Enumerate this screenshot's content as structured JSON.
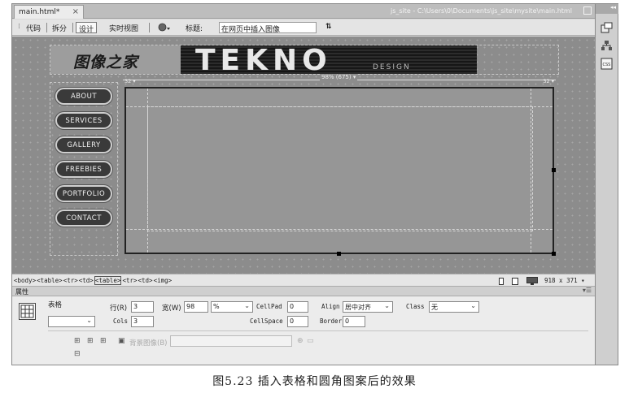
{
  "tab": {
    "label": "main.html*",
    "close": "×"
  },
  "window_path": "js_site - C:\\Users\\0\\Documents\\js_site\\mysite\\main.html",
  "toolbar": {
    "code": "代码",
    "split": "拆分",
    "design": "设计",
    "live_view": "实时视图",
    "title_label": "标题:",
    "title_value": "在网页中插入图像",
    "sort_icon": "⇅"
  },
  "page": {
    "logo_text": "图像之家",
    "banner_text": "TEKNO",
    "banner_sub": "DESIGN",
    "nav_buttons": [
      "ABOUT",
      "SERVICES",
      "GALLERY",
      "FREEBIES",
      "PORTFOLIO",
      "CONTACT"
    ],
    "ruler_label": "98% (675) ▾",
    "ruler_left": "32 ▾",
    "ruler_right": "32 ▾"
  },
  "status": {
    "tags": [
      "<body>",
      "<table>",
      "<tr>",
      "<td>",
      "<table>",
      "<tr>",
      "<td>",
      "<img>"
    ],
    "selected_tag_index": 4,
    "size": "918 x 371 ▾"
  },
  "properties": {
    "panel_title": "属性",
    "object_label": "表格",
    "rows_label": "行(R)",
    "rows_value": "3",
    "width_label": "宽(W)",
    "width_value": "98",
    "width_unit": "%",
    "cols_label": "Cols",
    "cols_value": "3",
    "cellpad_label": "CellPad",
    "cellpad_value": "0",
    "cellspace_label": "CellSpace",
    "cellspace_value": "0",
    "align_label": "Align",
    "align_value": "居中对齐",
    "border_label": "Border",
    "border_value": "0",
    "class_label": "Class",
    "class_value": "无",
    "bg_label": "背景图像(B)"
  },
  "caption": "图5.23    插入表格和圆角图案后的效果",
  "icons": {
    "right_strip": [
      "insert-panel-icon",
      "site-map-icon",
      "css-panel-icon"
    ],
    "properties": [
      "clear-height-icon",
      "clear-width-icon",
      "convert-icon",
      "image-icon",
      "folder-icon",
      "target-icon"
    ]
  }
}
